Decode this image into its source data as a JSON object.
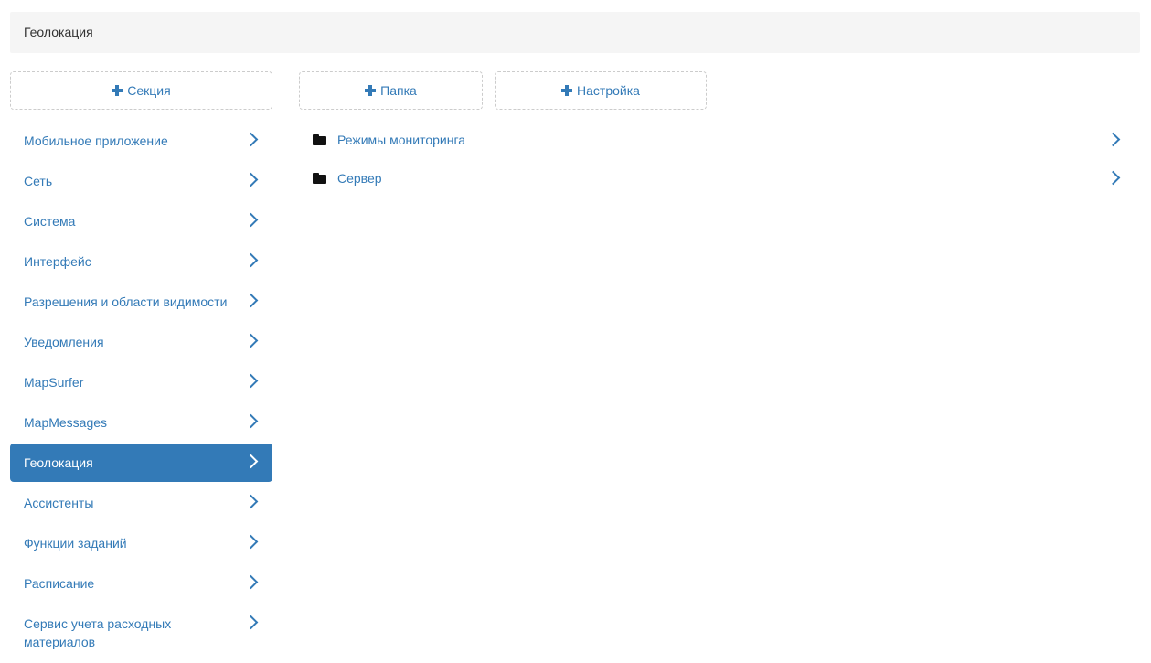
{
  "breadcrumb": {
    "current": "Геолокация"
  },
  "toolbar": {
    "add_section_label": "Секция",
    "add_folder_label": "Папка",
    "add_setting_label": "Настройка"
  },
  "sidebar": {
    "items": [
      {
        "label": "Мобильное приложение",
        "active": false
      },
      {
        "label": "Сеть",
        "active": false
      },
      {
        "label": "Система",
        "active": false
      },
      {
        "label": "Интерфейс",
        "active": false
      },
      {
        "label": "Разрешения и области видимости",
        "active": false
      },
      {
        "label": "Уведомления",
        "active": false
      },
      {
        "label": "MapSurfer",
        "active": false
      },
      {
        "label": "MapMessages",
        "active": false
      },
      {
        "label": "Геолокация",
        "active": true
      },
      {
        "label": "Ассистенты",
        "active": false
      },
      {
        "label": "Функции заданий",
        "active": false
      },
      {
        "label": "Расписание",
        "active": false
      },
      {
        "label": "Сервис учета расходных материалов",
        "active": false
      }
    ]
  },
  "content": {
    "folders": [
      {
        "label": "Режимы мониторинга"
      },
      {
        "label": "Сервер"
      }
    ]
  },
  "colors": {
    "accent": "#337ab7",
    "breadcrumb_bg": "#f5f5f5",
    "text": "#333333",
    "folder_icon": "#111111"
  }
}
